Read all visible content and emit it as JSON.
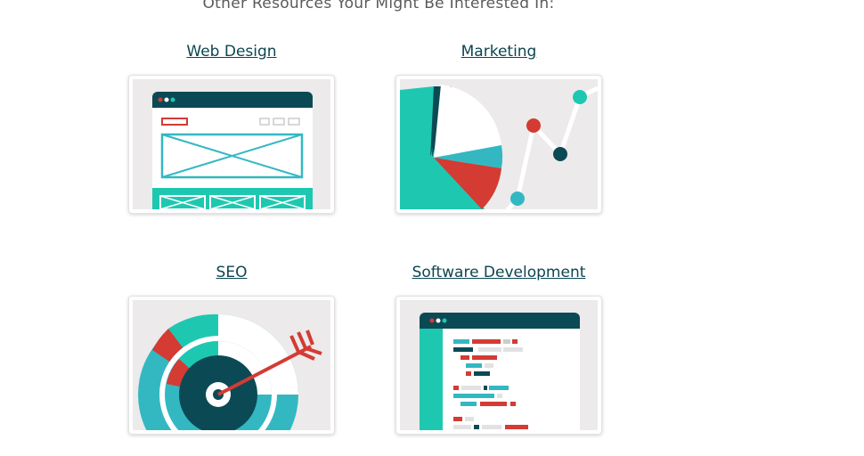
{
  "heading": "Other Resources Your Might Be Interested In:",
  "resources": [
    {
      "title": "Web Design",
      "icon": "web-design-illustration"
    },
    {
      "title": "Marketing",
      "icon": "marketing-chart-illustration"
    },
    {
      "title": "SEO",
      "icon": "seo-target-illustration"
    },
    {
      "title": "Software Development",
      "icon": "code-editor-illustration"
    }
  ],
  "colors": {
    "teal": "#1ec8b0",
    "dark_teal": "#0b4a55",
    "red": "#d33b33",
    "mid_teal": "#33b8c2",
    "bg": "#eceaea",
    "link": "#0c4650"
  }
}
